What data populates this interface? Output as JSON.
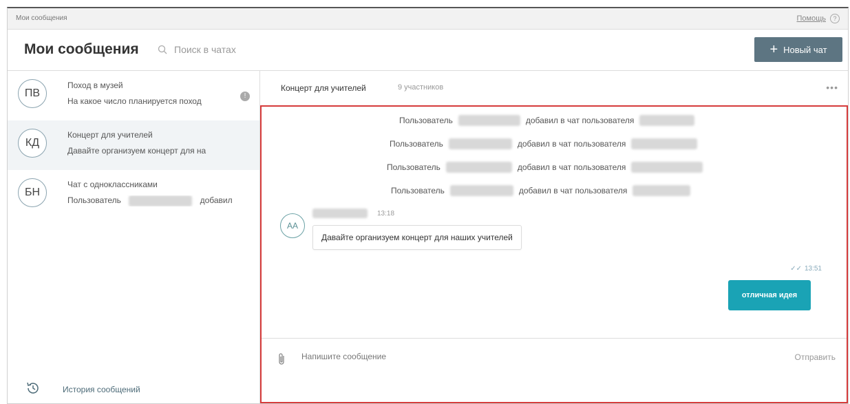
{
  "topbar": {
    "breadcrumb": "Мои сообщения",
    "help": "Помощь",
    "help_icon": "?"
  },
  "header": {
    "title": "Мои сообщения",
    "search_placeholder": "Поиск в чатах",
    "new_chat_plus": "+",
    "new_chat_label": "Новый чат"
  },
  "sidebar": {
    "chats": [
      {
        "initials": "ПВ",
        "name": "Поход в музей",
        "preview": "На какое число планируется поход",
        "badge": "!"
      },
      {
        "initials": "КД",
        "name": "Концерт для учителей",
        "preview": "Давайте организуем концерт для на"
      },
      {
        "initials": "БН",
        "name": "Чат с одноклассниками",
        "preview_prefix": "Пользователь",
        "preview_suffix": "добавил"
      }
    ],
    "history_label": "История сообщений"
  },
  "chat": {
    "title": "Концерт для учителей",
    "participants": "9 участников",
    "more": "•••",
    "system_messages": [
      {
        "prefix": "Пользователь",
        "middle": "добавил в чат пользователя"
      },
      {
        "prefix": "Пользователь",
        "middle": "добавил в чат пользователя"
      },
      {
        "prefix": "Пользователь",
        "middle": "добавил в чат пользователя"
      },
      {
        "prefix": "Пользователь",
        "middle": "добавил в чат пользователя"
      }
    ],
    "incoming": {
      "avatar": "АА",
      "time": "13:18",
      "text": "Давайте организуем концерт для наших учителей"
    },
    "outgoing": {
      "checks": "✓✓",
      "time": "13:51",
      "text": "отличная идея"
    },
    "composer": {
      "placeholder": "Напишите сообщение",
      "send_label": "Отправить"
    }
  },
  "colors": {
    "accent": "#1aa3b5",
    "new_chat_bg": "#5d7582",
    "highlight_border": "#d63a3a"
  }
}
